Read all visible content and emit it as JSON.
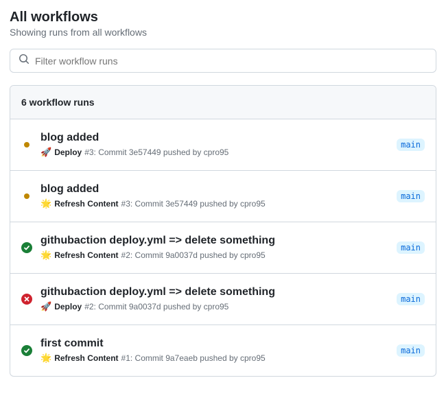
{
  "header": {
    "title": "All workflows",
    "subtitle": "Showing runs from all workflows"
  },
  "filter": {
    "placeholder": "Filter workflow runs"
  },
  "list": {
    "count_label": "6 workflow runs"
  },
  "runs": [
    {
      "status": "pending",
      "title": "blog added",
      "emoji": "🚀",
      "workflow": "Deploy",
      "run_number": "#3",
      "commit": "3e57449",
      "actor": "cpro95",
      "branch": "main"
    },
    {
      "status": "pending",
      "title": "blog added",
      "emoji": "🌟",
      "workflow": "Refresh Content",
      "run_number": "#3",
      "commit": "3e57449",
      "actor": "cpro95",
      "branch": "main"
    },
    {
      "status": "success",
      "title": "githubaction deploy.yml => delete something",
      "emoji": "🌟",
      "workflow": "Refresh Content",
      "run_number": "#2",
      "commit": "9a0037d",
      "actor": "cpro95",
      "branch": "main"
    },
    {
      "status": "failure",
      "title": "githubaction deploy.yml => delete something",
      "emoji": "🚀",
      "workflow": "Deploy",
      "run_number": "#2",
      "commit": "9a0037d",
      "actor": "cpro95",
      "branch": "main"
    },
    {
      "status": "success",
      "title": "first commit",
      "emoji": "🌟",
      "workflow": "Refresh Content",
      "run_number": "#1",
      "commit": "9a7eaeb",
      "actor": "cpro95",
      "branch": "main"
    }
  ]
}
